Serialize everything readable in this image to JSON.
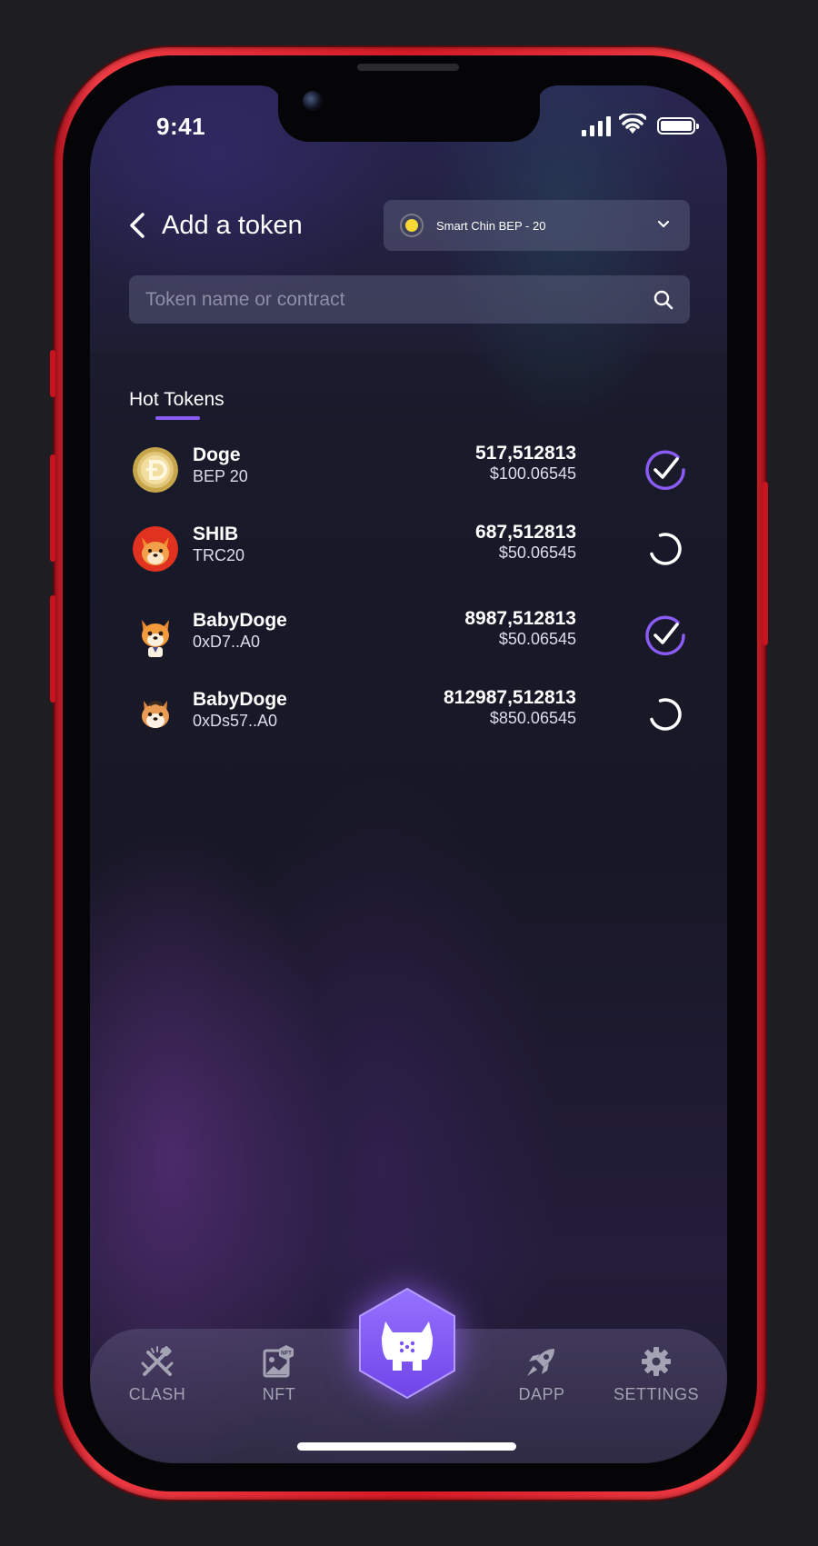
{
  "status_bar": {
    "time": "9:41"
  },
  "header": {
    "title": "Add a token",
    "network": "Smart Chin BEP - 20"
  },
  "search": {
    "placeholder": "Token name or contract",
    "value": ""
  },
  "section": {
    "title": "Hot Tokens"
  },
  "tokens": [
    {
      "name": "Doge",
      "network": "BEP 20",
      "amount": "517,512813",
      "usd": "$100.06545",
      "added": true
    },
    {
      "name": "SHIB",
      "network": "TRC20",
      "amount": "687,512813",
      "usd": "$50.06545",
      "added": false
    },
    {
      "name": "BabyDoge",
      "network": "0xD7..A0",
      "amount": "8987,512813",
      "usd": "$50.06545",
      "added": true
    },
    {
      "name": "BabyDoge",
      "network": "0xDs57..A0",
      "amount": "812987,512813",
      "usd": "$850.06545",
      "added": false
    }
  ],
  "nav": {
    "clash": "CLASH",
    "nft": "NFT",
    "dapp": "DAPP",
    "settings": "SETTINGS"
  },
  "colors": {
    "accent": "#8a5cf6",
    "frame": "#e0202c",
    "coin": "#f5d735"
  }
}
